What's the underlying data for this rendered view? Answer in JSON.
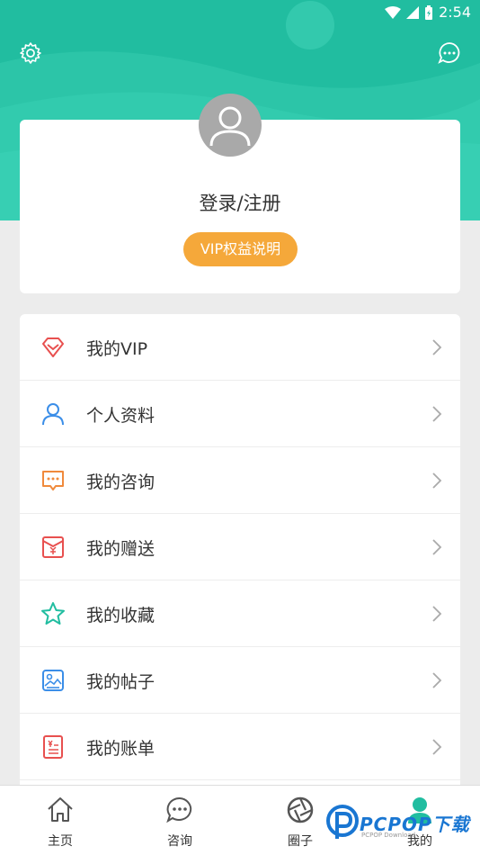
{
  "status_bar": {
    "time": "2:54"
  },
  "header": {
    "settings_icon": "gear-icon",
    "message_icon": "chat-bubble-icon"
  },
  "profile": {
    "login_label": "登录/注册",
    "vip_button": "VIP权益说明"
  },
  "menu": {
    "items": [
      {
        "label": "我的VIP",
        "icon": "diamond-icon",
        "color": "#e8504f"
      },
      {
        "label": "个人资料",
        "icon": "person-icon",
        "color": "#3b8ee8"
      },
      {
        "label": "我的咨询",
        "icon": "chat-dots-icon",
        "color": "#f08a3c"
      },
      {
        "label": "我的赠送",
        "icon": "gift-envelope-icon",
        "color": "#e8504f"
      },
      {
        "label": "我的收藏",
        "icon": "star-icon",
        "color": "#21bda0"
      },
      {
        "label": "我的帖子",
        "icon": "picture-icon",
        "color": "#3b8ee8"
      },
      {
        "label": "我的账单",
        "icon": "bill-icon",
        "color": "#e8504f"
      }
    ]
  },
  "tabbar": {
    "tabs": [
      {
        "label": "主页",
        "icon": "home-icon"
      },
      {
        "label": "咨询",
        "icon": "chat-icon"
      },
      {
        "label": "圈子",
        "icon": "aperture-icon"
      },
      {
        "label": "我的",
        "icon": "user-icon",
        "active": true
      }
    ]
  },
  "watermark": {
    "brand": "PCPOP下载",
    "sub": "PCPOP Download"
  },
  "colors": {
    "header": "#21bda0",
    "accent_orange": "#f5a83a",
    "background": "#ececec"
  }
}
